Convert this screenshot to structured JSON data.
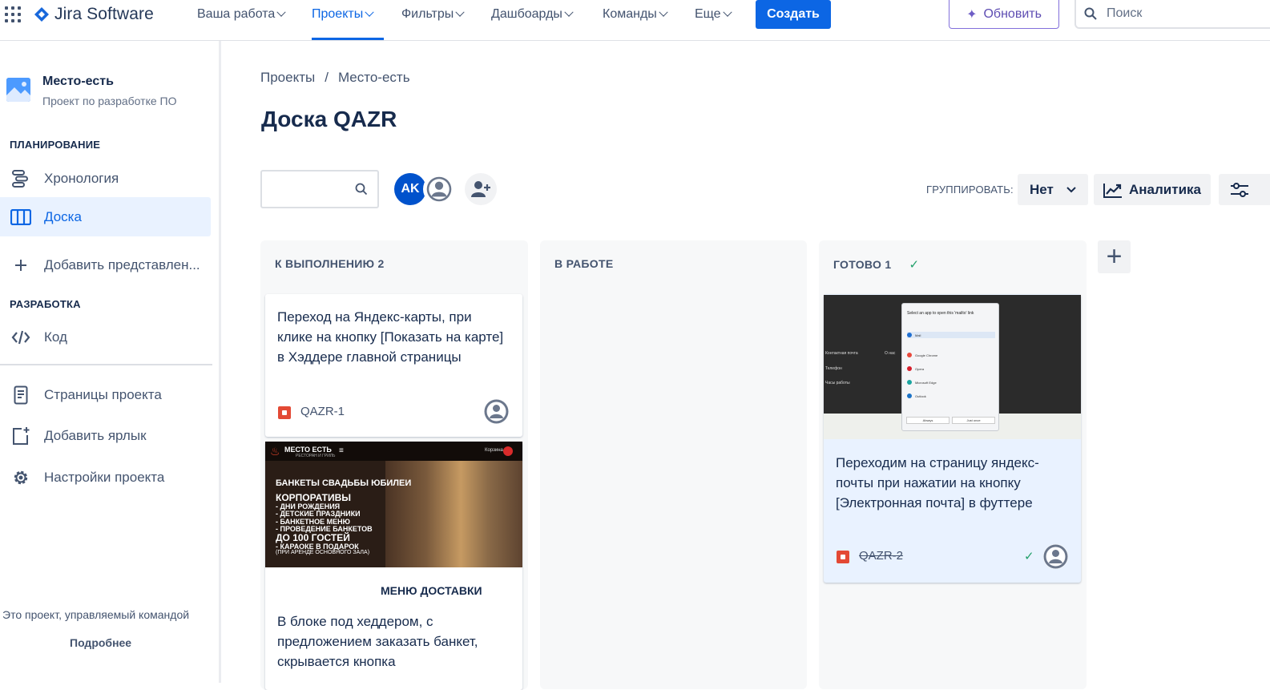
{
  "topbar": {
    "apps_icon": "apps-grid-icon",
    "logo_text": "Jira Software",
    "nav": [
      "Ваша работа",
      "Проекты",
      "Фильтры",
      "Дашбоарды",
      "Команды",
      "Еще"
    ],
    "active_nav": "Проекты",
    "create_label": "Создать",
    "upgrade_label": "Обновить",
    "search_placeholder": "Поиск"
  },
  "sidebar": {
    "project_name": "Место-есть",
    "project_type": "Проект по разработке ПО",
    "section_planning": "ПЛАНИРОВАНИЕ",
    "items_planning": [
      "Хронология",
      "Доска",
      "Добавить представлен..."
    ],
    "section_dev": "РАЗРАБОТКА",
    "items_dev": [
      "Код"
    ],
    "items_other": [
      "Страницы проекта",
      "Добавить ярлык",
      "Настройки проекта"
    ],
    "footer_text": "Это проект, управляемый командой",
    "footer_link": "Подробнее"
  },
  "board": {
    "breadcrumb": [
      "Проекты",
      "Место-есть"
    ],
    "breadcrumb_sep": "/",
    "title": "Доска QAZR",
    "avatar_initials": "AK",
    "group_label": "ГРУППИРОВАТЬ:",
    "group_value": "Нет",
    "analytics_label": "Аналитика",
    "columns": [
      {
        "title": "К ВЫПОЛНЕНИЮ 2"
      },
      {
        "title": "В РАБОТЕ"
      },
      {
        "title": "ГОТОВО 1"
      }
    ],
    "cards": [
      {
        "text": "Переход на Яндекс-карты, при клике на кнопку [Показать на карте] в Хэддере главной страницы",
        "key": "QAZR-1"
      },
      {
        "text": "В блоке под хеддером, с предложением заказать банкет, скрывается кнопка",
        "key": ""
      },
      {
        "text": "Переходим на страницу яндекс-почты при нажатии на кнопку [Электронная почта] в футтере",
        "key": "QAZR-2"
      }
    ]
  },
  "promo_image": {
    "logo": "МЕСТО ЕСТЬ",
    "logo_sub": "РЕСТОРАН И ГРИЛЬ",
    "cart": "Корзина",
    "lines": [
      "БАНКЕТЫ СВАДЬБЫ ЮБИЛЕИ",
      "КОРПОРАТИВЫ",
      "- ДНИ РОЖДЕНИЯ",
      "- ДЕТСКИЕ ПРАЗДНИКИ",
      "- БАНКЕТНОЕ МЕНЮ",
      "- ПРОВЕДЕНИЕ БАНКЕТОВ",
      "ДО 100 ГОСТЕЙ",
      "- КАРАОКЕ В ПОДАРОК",
      "(ПРИ АРЕНДЕ ОСНОВНОГО ЗАЛА)"
    ],
    "menu_heading": "МЕНЮ ДОСТАВКИ"
  },
  "shot_image": {
    "dialog_title": "Select an app to open this 'mailto' link",
    "apps": [
      "Mail",
      "Google Chrome",
      "Opera",
      "Microsoft Edge",
      "Outlook"
    ],
    "left_texts": [
      "Контактная почта",
      "О нас",
      "Телефон",
      "Часы работы"
    ],
    "buttons": [
      "Always",
      "Just once"
    ]
  },
  "colors": {
    "brand_blue": "#0c66e4",
    "done_green": "#22a06b",
    "story_red": "#e34935",
    "upgrade_purple": "#8270db"
  }
}
